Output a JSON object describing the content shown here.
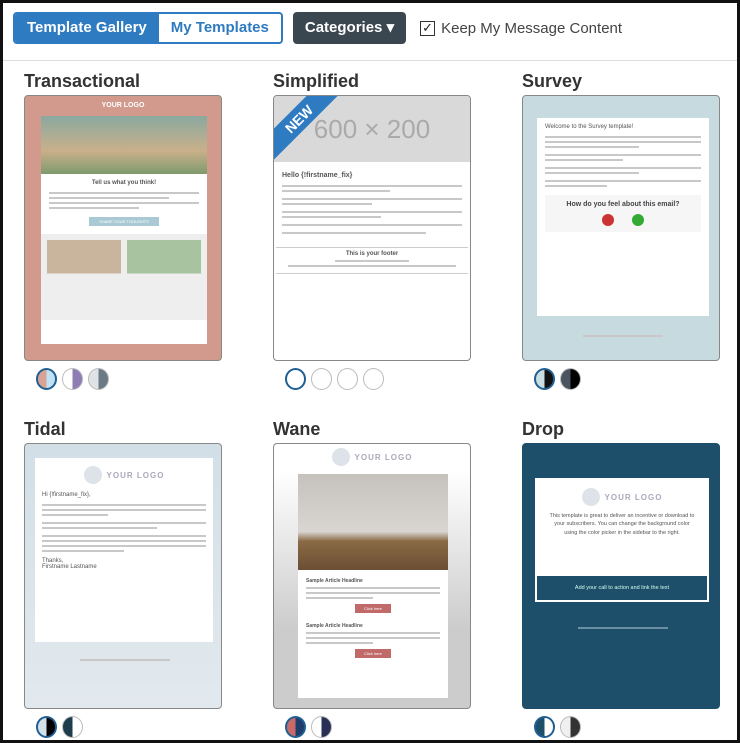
{
  "toolbar": {
    "tabs": [
      {
        "label": "Template Gallery",
        "active": true
      },
      {
        "label": "My Templates",
        "active": false
      }
    ],
    "categories_label": "Categories ▾",
    "keep_content_label": "Keep My Message Content",
    "keep_content_checked": true
  },
  "colors": {
    "accent": "#2f7bc1",
    "dark_button": "#3a4750"
  },
  "templates": [
    {
      "name": "Transactional",
      "logo": "YOUR LOGO",
      "heading": "Tell us what you think!",
      "button": "SHARE YOUR THOUGHTS",
      "swatches": [
        [
          "#d8a395",
          "#bfe3f5"
        ],
        [
          "#ffffff",
          "#8e7cb5"
        ],
        [
          "#dfe3e5",
          "#6b7b85"
        ]
      ]
    },
    {
      "name": "Simplified",
      "badge": "NEW",
      "banner": "600 × 200",
      "greeting": "Hello {!firstname_fix}",
      "footer_title": "This is your footer",
      "swatches": [
        [
          "#ffffff",
          "#ffffff"
        ],
        [
          "#ffffff",
          "#ffffff"
        ],
        [
          "#ffffff",
          "#ffffff"
        ],
        [
          "#ffffff",
          "#ffffff"
        ]
      ]
    },
    {
      "name": "Survey",
      "intro": "Welcome to the Survey template!",
      "question": "How do you feel about this email?",
      "swatches": [
        [
          "#c9dde2",
          "#111111"
        ],
        [
          "#4a5560",
          "#000000"
        ]
      ]
    },
    {
      "name": "Tidal",
      "logo": "YOUR LOGO",
      "greeting": "Hi {!firstname_fix},",
      "signoff": "Thanks,",
      "signature": "Firstname Lastname",
      "swatches": [
        [
          "#d6e2ea",
          "#000000"
        ],
        [
          "#1e3d4c",
          "#ffffff"
        ]
      ]
    },
    {
      "name": "Wane",
      "logo": "YOUR LOGO",
      "headline": "Sample Article Headline",
      "button": "Click here",
      "swatches": [
        [
          "#c96a6a",
          "#1e3d6a"
        ],
        [
          "#ffffff",
          "#2a2f55"
        ]
      ]
    },
    {
      "name": "Drop",
      "logo": "YOUR LOGO",
      "body": "This template is great to deliver an incentive or download to your subscribers. You can change the background color using the color picker in the sidebar to the right.",
      "cta": "Add your call to action and link the text",
      "swatches": [
        [
          "#1e4f6a",
          "#ffffff"
        ],
        [
          "#f0f0f0",
          "#333333"
        ]
      ]
    }
  ]
}
